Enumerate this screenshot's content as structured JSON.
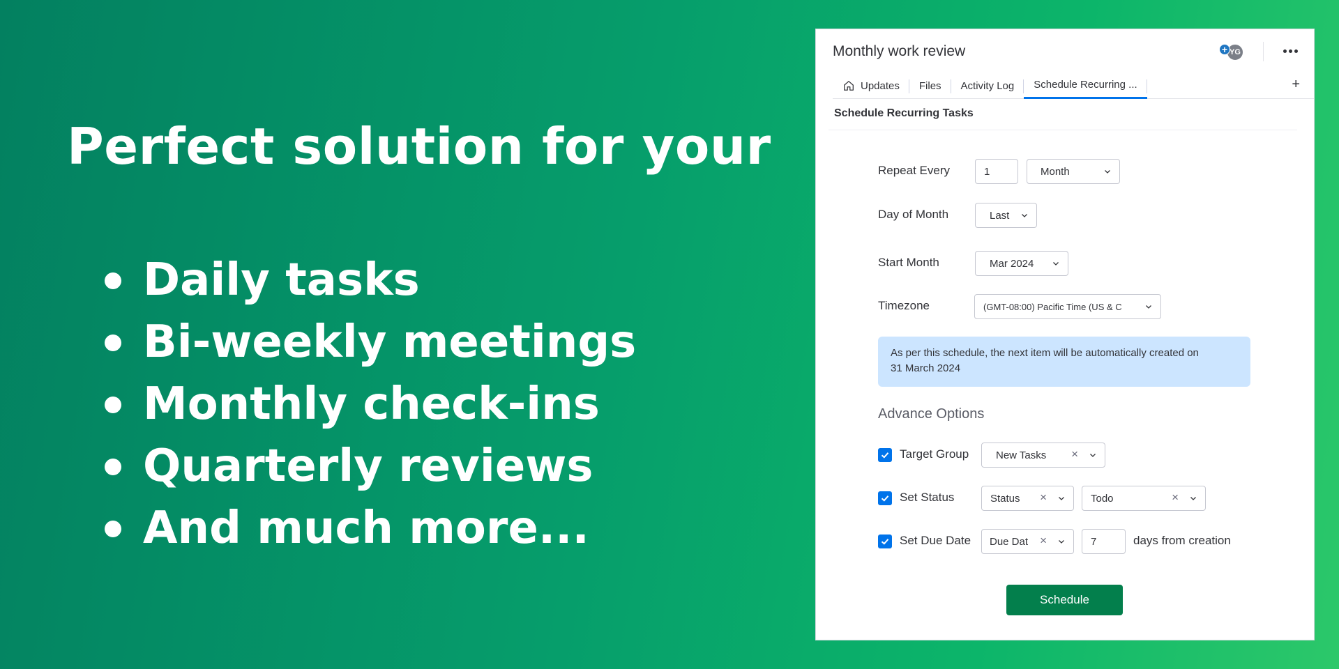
{
  "promo": {
    "headline": "Perfect solution for your",
    "features": [
      "Daily tasks",
      "Bi-weekly meetings",
      "Monthly check-ins",
      "Quarterly reviews",
      "And much more..."
    ]
  },
  "panel": {
    "board_title": "Monthly work review",
    "avatar_initials": "YG",
    "tabs": [
      {
        "label": "Updates",
        "icon": "home-icon"
      },
      {
        "label": "Files"
      },
      {
        "label": "Activity Log"
      },
      {
        "label": "Schedule Recurring ...",
        "active": true
      }
    ],
    "add_tab_label": "+",
    "section_title": "Schedule Recurring Tasks",
    "form": {
      "repeat_every_label": "Repeat Every",
      "repeat_every_value": "1",
      "repeat_unit": "Month",
      "day_of_month_label": "Day of Month",
      "day_of_month_value": "Last",
      "start_month_label": "Start Month",
      "start_month_value": "Mar 2024",
      "timezone_label": "Timezone",
      "timezone_value": "(GMT-08:00) Pacific Time (US & C"
    },
    "info": {
      "line1": "As per this schedule, the next item will be automatically created on",
      "line2": "31 March 2024"
    },
    "advance": {
      "title": "Advance Options",
      "target_group_label": "Target Group",
      "target_group_value": "New Tasks",
      "set_status_label": "Set Status",
      "status_column_value": "Status",
      "status_value": "Todo",
      "set_due_date_label": "Set Due Date",
      "due_date_column_value": "Due Dat",
      "due_days_value": "7",
      "due_suffix": "days from creation",
      "target_group_checked": true,
      "set_status_checked": true,
      "set_due_date_checked": true
    },
    "schedule_button_label": "Schedule"
  },
  "colors": {
    "accent": "#0073ea",
    "primary_button": "#037f4c",
    "info_background": "#cce5ff"
  }
}
